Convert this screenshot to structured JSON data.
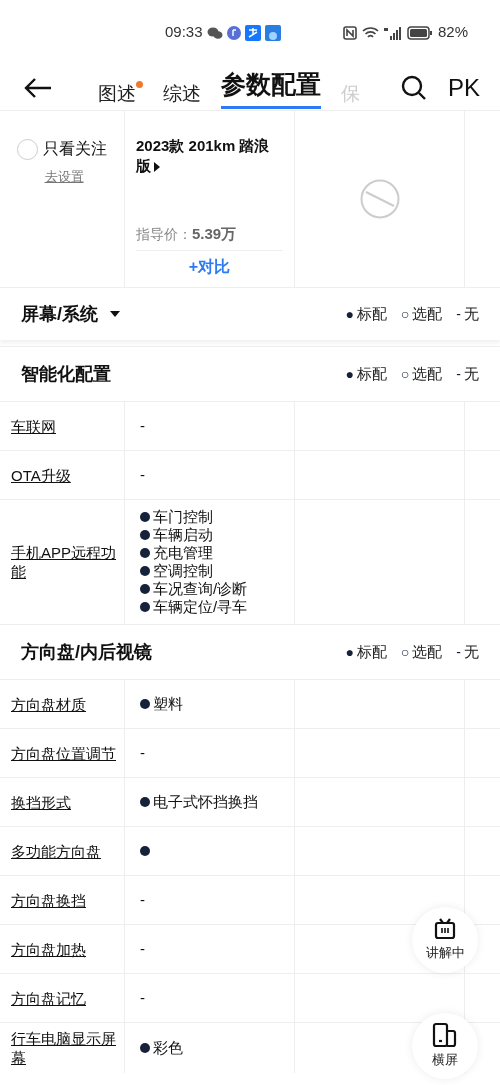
{
  "status_bar": {
    "time": "09:33",
    "battery": "82%"
  },
  "nav": {
    "tabs": [
      {
        "label": "图述",
        "selected": false,
        "dot": true
      },
      {
        "label": "综述",
        "selected": false,
        "dot": false
      },
      {
        "label": "参数配置",
        "selected": true,
        "dot": false
      },
      {
        "label": "保",
        "selected": false,
        "dot": false
      }
    ],
    "pk": "PK"
  },
  "header": {
    "follow_only": {
      "label": "只看关注",
      "checked": false
    },
    "settings_link": "去设置",
    "model": {
      "name": "2023款 201km 踏浪版",
      "price_label": "指导价：",
      "price": "5.39万",
      "compare": "+对比"
    }
  },
  "pinned_category": {
    "title": "屏幕/系统",
    "legend": [
      {
        "symbol": "●",
        "label": "标配"
      },
      {
        "symbol": "○",
        "label": "选配"
      },
      {
        "symbol": "-",
        "label": "无"
      }
    ]
  },
  "sections": [
    {
      "title": "智能化配置",
      "legend": [
        {
          "symbol": "●",
          "label": "标配"
        },
        {
          "symbol": "○",
          "label": "选配"
        },
        {
          "symbol": "-",
          "label": "无"
        }
      ],
      "rows": [
        {
          "label": "车联网",
          "value": {
            "kind": "dash",
            "text": "-"
          }
        },
        {
          "label": "OTA升级",
          "value": {
            "kind": "dash",
            "text": "-"
          }
        },
        {
          "label": "手机APP远程功能",
          "value": {
            "kind": "bullets",
            "items": [
              "车门控制",
              "车辆启动",
              "充电管理",
              "空调控制",
              "车况查询/诊断",
              "车辆定位/寻车"
            ]
          }
        }
      ]
    },
    {
      "title": "方向盘/内后视镜",
      "legend": [
        {
          "symbol": "●",
          "label": "标配"
        },
        {
          "symbol": "○",
          "label": "选配"
        },
        {
          "symbol": "-",
          "label": "无"
        }
      ],
      "rows": [
        {
          "label": "方向盘材质",
          "value": {
            "kind": "bullets",
            "items": [
              "塑料"
            ]
          }
        },
        {
          "label": "方向盘位置调节",
          "value": {
            "kind": "dash",
            "text": "-"
          }
        },
        {
          "label": "换挡形式",
          "value": {
            "kind": "bullets",
            "items": [
              "电子式怀挡换挡"
            ]
          }
        },
        {
          "label": "多功能方向盘",
          "value": {
            "kind": "dot"
          }
        },
        {
          "label": "方向盘换挡",
          "value": {
            "kind": "dash",
            "text": "-"
          }
        },
        {
          "label": "方向盘加热",
          "value": {
            "kind": "dash",
            "text": "-"
          }
        },
        {
          "label": "方向盘记忆",
          "value": {
            "kind": "dash",
            "text": "-"
          }
        },
        {
          "label": "行车电脑显示屏幕",
          "value": {
            "kind": "bullets",
            "items": [
              "彩色"
            ]
          }
        }
      ]
    }
  ],
  "floating": [
    {
      "kind": "live",
      "label": "讲解中"
    },
    {
      "kind": "rotate",
      "label": "横屏"
    }
  ]
}
